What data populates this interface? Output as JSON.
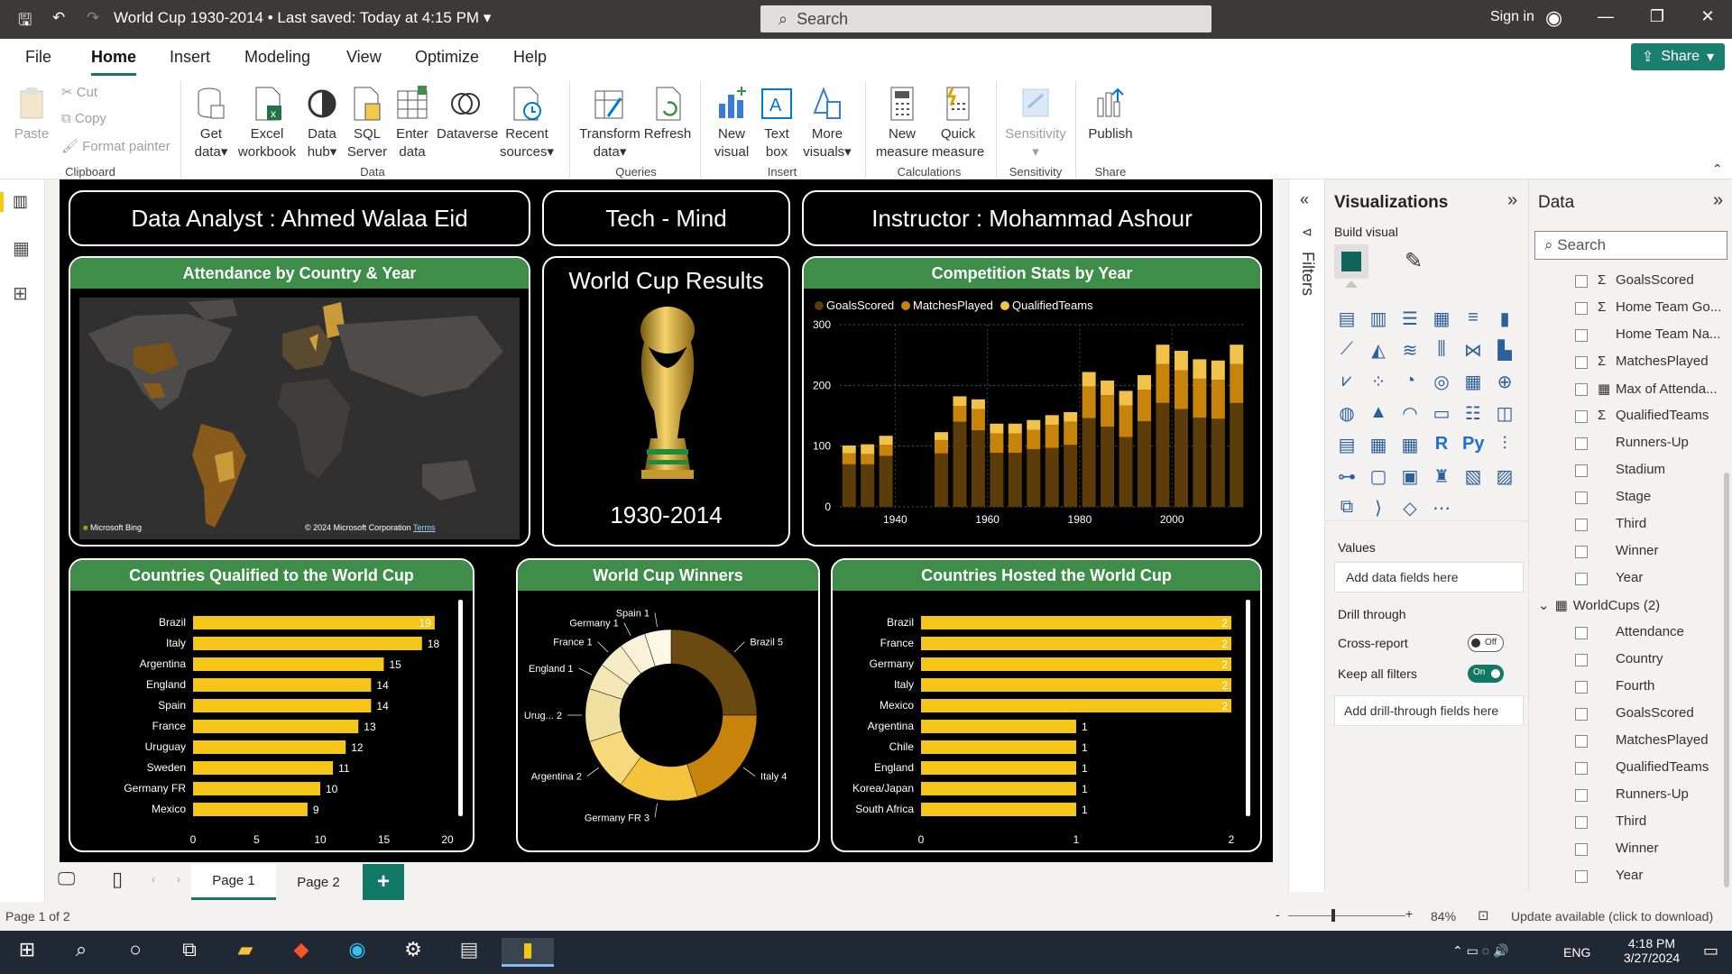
{
  "title": {
    "doc": "World Cup 1930-2014",
    "saved": "Last saved: Today at 4:15 PM",
    "search_placeholder": "Search",
    "signin": "Sign in"
  },
  "menu": [
    "File",
    "Home",
    "Insert",
    "Modeling",
    "View",
    "Optimize",
    "Help"
  ],
  "share": "Share",
  "ribbon": {
    "clipboard": {
      "paste": "Paste",
      "cut": "Cut",
      "copy": "Copy",
      "format": "Format painter",
      "group": "Clipboard"
    },
    "data": {
      "get": [
        "Get",
        "data"
      ],
      "excel": [
        "Excel",
        "workbook"
      ],
      "hub": [
        "Data",
        "hub"
      ],
      "sql": [
        "SQL",
        "Server"
      ],
      "enter": [
        "Enter",
        "data"
      ],
      "dataverse": "Dataverse",
      "recent": [
        "Recent",
        "sources"
      ],
      "group": "Data"
    },
    "queries": {
      "transform": [
        "Transform",
        "data"
      ],
      "refresh": "Refresh",
      "group": "Queries"
    },
    "insert": {
      "visual": [
        "New",
        "visual"
      ],
      "textbox": [
        "Text",
        "box"
      ],
      "more": [
        "More",
        "visuals"
      ],
      "group": "Insert"
    },
    "calc": {
      "measure": [
        "New",
        "measure"
      ],
      "quick": [
        "Quick",
        "measure"
      ],
      "group": "Calculations"
    },
    "sens": {
      "label": "Sensitivity",
      "group": "Sensitivity"
    },
    "share": {
      "publish": "Publish",
      "group": "Share"
    }
  },
  "dashboard": {
    "analyst": "Data Analyst : Ahmed Walaa Eid",
    "org": "Tech - Mind",
    "instructor": "Instructor : Mohammad Ashour",
    "map": {
      "title": "Attendance by Country & Year",
      "bing": "Microsoft Bing",
      "copyright": "© 2024 Microsoft Corporation",
      "terms": "Terms"
    },
    "results": {
      "title": "World Cup Results",
      "years": "1930-2014"
    },
    "comp_title": "Countries Qualified to the World Cup",
    "winners_title": "World Cup Winners",
    "hosted_title": "Countries Hosted the World Cup",
    "stats_title": "Competition Stats by Year"
  },
  "chart_data": [
    {
      "type": "bar",
      "title": "Competition Stats by Year",
      "legend": [
        "GoalsScored",
        "MatchesPlayed",
        "QualifiedTeams"
      ],
      "colors": [
        "#5c3d0a",
        "#c8830a",
        "#f1c24a"
      ],
      "x": [
        1930,
        1934,
        1938,
        1950,
        1954,
        1958,
        1962,
        1966,
        1970,
        1974,
        1978,
        1982,
        1986,
        1990,
        1994,
        1998,
        2002,
        2006,
        2010,
        2014
      ],
      "xticks": [
        1940,
        1960,
        1980,
        2000
      ],
      "ylim": [
        0,
        300
      ],
      "yticks": [
        0,
        100,
        200,
        300
      ],
      "series": [
        {
          "name": "GoalsScored",
          "values": [
            70,
            70,
            84,
            88,
            140,
            126,
            89,
            89,
            95,
            97,
            102,
            146,
            132,
            115,
            141,
            171,
            161,
            147,
            145,
            171
          ]
        },
        {
          "name": "MatchesPlayed",
          "values": [
            18,
            17,
            18,
            22,
            26,
            35,
            32,
            32,
            32,
            38,
            38,
            52,
            52,
            52,
            52,
            64,
            64,
            64,
            64,
            64
          ]
        },
        {
          "name": "QualifiedTeams",
          "values": [
            13,
            16,
            15,
            13,
            16,
            16,
            16,
            16,
            16,
            16,
            16,
            24,
            24,
            24,
            24,
            32,
            32,
            32,
            32,
            32
          ]
        }
      ]
    },
    {
      "type": "bar",
      "title": "Countries Qualified to the World Cup",
      "categories": [
        "Brazil",
        "Italy",
        "Argentina",
        "England",
        "Spain",
        "France",
        "Uruguay",
        "Sweden",
        "Germany FR",
        "Mexico"
      ],
      "values": [
        19,
        18,
        15,
        14,
        14,
        13,
        12,
        11,
        10,
        9
      ],
      "xlim": [
        0,
        20
      ],
      "xticks": [
        0,
        5,
        10,
        15,
        20
      ],
      "color": "#f5c518"
    },
    {
      "type": "pie",
      "title": "World Cup Winners",
      "categories": [
        "Brazil",
        "Italy",
        "Germany FR",
        "Argentina",
        "Uruguay",
        "England",
        "France",
        "Germany",
        "Spain"
      ],
      "values": [
        5,
        4,
        3,
        2,
        2,
        1,
        1,
        1,
        1
      ],
      "labels": [
        "Brazil 5",
        "Italy 4",
        "Germany FR 3",
        "Argentina 2",
        "Urug... 2",
        "England 1",
        "France 1",
        "Germany 1",
        "Spain 1"
      ],
      "colors": [
        "#6b4a12",
        "#c8830a",
        "#f5c33b",
        "#f7d97c",
        "#efe0a0",
        "#f4e6b5",
        "#f6edc8",
        "#f9f2d8",
        "#fdf8e6"
      ]
    },
    {
      "type": "bar",
      "title": "Countries Hosted the World Cup",
      "categories": [
        "Brazil",
        "France",
        "Germany",
        "Italy",
        "Mexico",
        "Argentina",
        "Chile",
        "England",
        "Korea/Japan",
        "South Africa"
      ],
      "values": [
        2,
        2,
        2,
        2,
        2,
        1,
        1,
        1,
        1,
        1
      ],
      "xlim": [
        0,
        2
      ],
      "xticks": [
        0,
        1,
        2
      ],
      "color": "#f5c518"
    }
  ],
  "viz": {
    "title": "Visualizations",
    "build": "Build visual",
    "values": "Values",
    "add_fields": "Add data fields here",
    "drill": "Drill through",
    "cross": "Cross-report",
    "cross_state": "Off",
    "keep": "Keep all filters",
    "keep_state": "On",
    "add_drill": "Add drill-through fields here",
    "filters": "Filters"
  },
  "data_pane": {
    "title": "Data",
    "search": "Search",
    "fields1": [
      {
        "name": "GoalsScored",
        "sigma": true
      },
      {
        "name": "Home Team Go...",
        "sigma": true
      },
      {
        "name": "Home Team Na...",
        "sigma": false
      },
      {
        "name": "MatchesPlayed",
        "sigma": true
      },
      {
        "name": "Max of Attenda...",
        "sigma": false,
        "table": true
      },
      {
        "name": "QualifiedTeams",
        "sigma": true
      },
      {
        "name": "Runners-Up",
        "sigma": false
      },
      {
        "name": "Stadium",
        "sigma": false
      },
      {
        "name": "Stage",
        "sigma": false
      },
      {
        "name": "Third",
        "sigma": false
      },
      {
        "name": "Winner",
        "sigma": false
      },
      {
        "name": "Year",
        "sigma": false
      }
    ],
    "table": "WorldCups (2)",
    "fields2": [
      "Attendance",
      "Country",
      "Fourth",
      "GoalsScored",
      "MatchesPlayed",
      "QualifiedTeams",
      "Runners-Up",
      "Third",
      "Winner",
      "Year"
    ]
  },
  "pages": {
    "p1": "Page 1",
    "p2": "Page 2"
  },
  "status": {
    "page": "Page 1 of 2",
    "zoom": "84%",
    "update": "Update available (click to download)"
  },
  "taskbar": {
    "time": "4:18 PM",
    "date": "3/27/2024",
    "lang": "ENG"
  }
}
